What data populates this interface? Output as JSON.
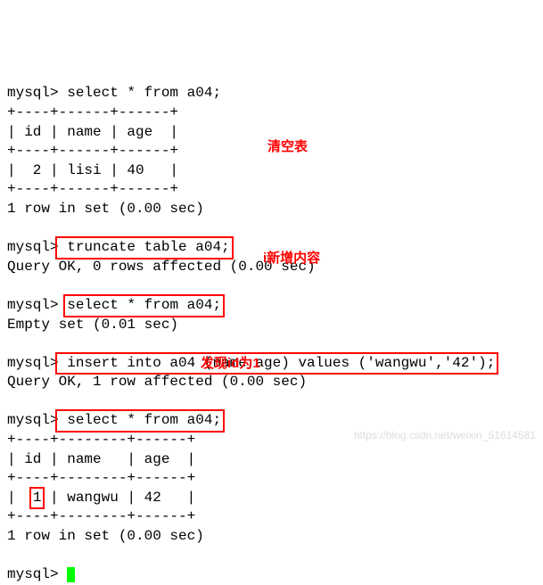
{
  "prompt": "mysql>",
  "sql1": " select * from a04;",
  "table1_border_top": "+----+------+------+",
  "table1_header": "| id | name | age  |",
  "table1_border_mid": "+----+------+------+",
  "table1_row": "|  2 | lisi | 40   |",
  "table1_border_bot": "+----+------+------+",
  "result1": "1 row in set (0.00 sec)",
  "anno1": "清空表",
  "sql2": " truncate table a04;",
  "result2": "Query OK, 0 rows affected (0.00 sec)",
  "sql3": "select * from a04;",
  "result3": "Empty set (0.01 sec)",
  "anno2": "i新增内容",
  "sql4": " insert into a04 (name,age) values ('wangwu','42');",
  "result4": "Query OK, 1 row affected (0.00 sec)",
  "sql5": " select * from a04;",
  "table2_border_top": "+----+--------+------+",
  "table2_header": "| id | name   | age  |",
  "table2_border_mid": "+----+--------+------+",
  "table2_row_pre": "|  ",
  "table2_row_id": "1",
  "table2_row_post": " | wangwu | 42   |",
  "table2_border_bot": "+----+--------+------+",
  "result5": "1 row in set (0.00 sec)",
  "anno3": "发现id为1",
  "watermark": "https://blog.csdn.net/weixin_51614581"
}
